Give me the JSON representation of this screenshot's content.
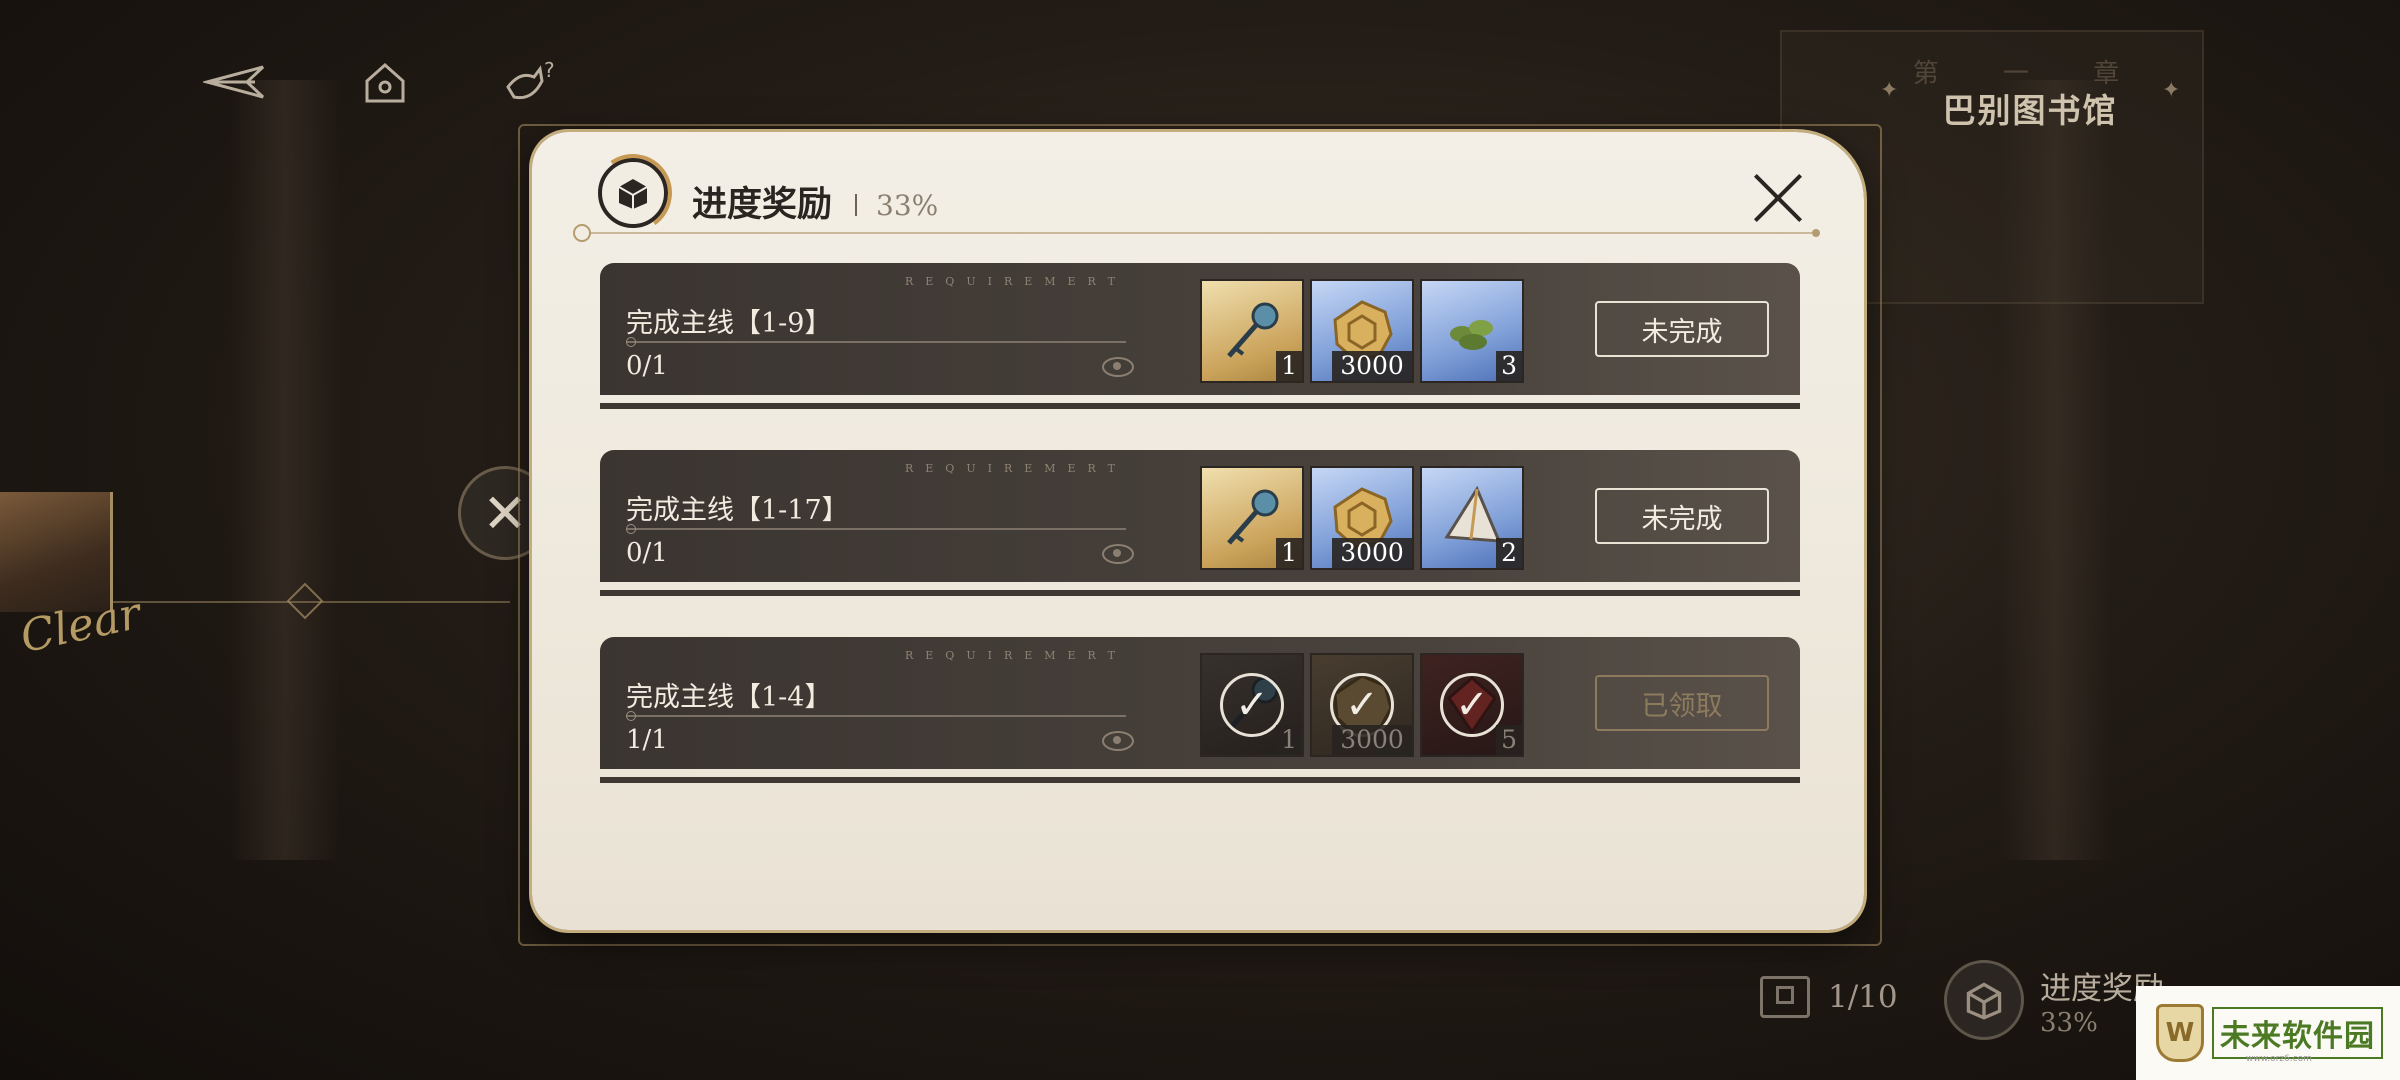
{
  "stage": {
    "chapter_label": "第 一 章",
    "name": "巴别图书馆"
  },
  "map": {
    "clear_label": "Clear"
  },
  "modal": {
    "title": "进度奖励",
    "percent": "33%",
    "tasks": [
      {
        "requirement_label": "REQUIREMERT",
        "name": "完成主线【1-9】",
        "progress": "0/1",
        "status": "未完成",
        "claimed": false,
        "rewards": [
          {
            "icon": "key-icon",
            "qty": "1"
          },
          {
            "icon": "gold-coin-icon",
            "qty": "3000"
          },
          {
            "icon": "herb-icon",
            "qty": "3"
          }
        ]
      },
      {
        "requirement_label": "REQUIREMERT",
        "name": "完成主线【1-17】",
        "progress": "0/1",
        "status": "未完成",
        "claimed": false,
        "rewards": [
          {
            "icon": "key-icon",
            "qty": "1"
          },
          {
            "icon": "gold-coin-icon",
            "qty": "3000"
          },
          {
            "icon": "crystal-prism-icon",
            "qty": "2"
          }
        ]
      },
      {
        "requirement_label": "REQUIREMERT",
        "name": "完成主线【1-4】",
        "progress": "1/1",
        "status": "已领取",
        "claimed": true,
        "rewards": [
          {
            "icon": "key-icon",
            "qty": "1"
          },
          {
            "icon": "gold-coin-icon",
            "qty": "3000"
          },
          {
            "icon": "red-gem-icon",
            "qty": "5"
          }
        ]
      }
    ]
  },
  "bottom": {
    "counter": "1/10",
    "progress_title": "进度奖励",
    "progress_percent": "33%"
  },
  "watermark": {
    "text": "未来软件园",
    "url": "www.orz6.com"
  },
  "colors": {
    "accent_gold": "#c69a55",
    "panel_bg": "#f3efe6",
    "row_bg": "#3b3531"
  }
}
